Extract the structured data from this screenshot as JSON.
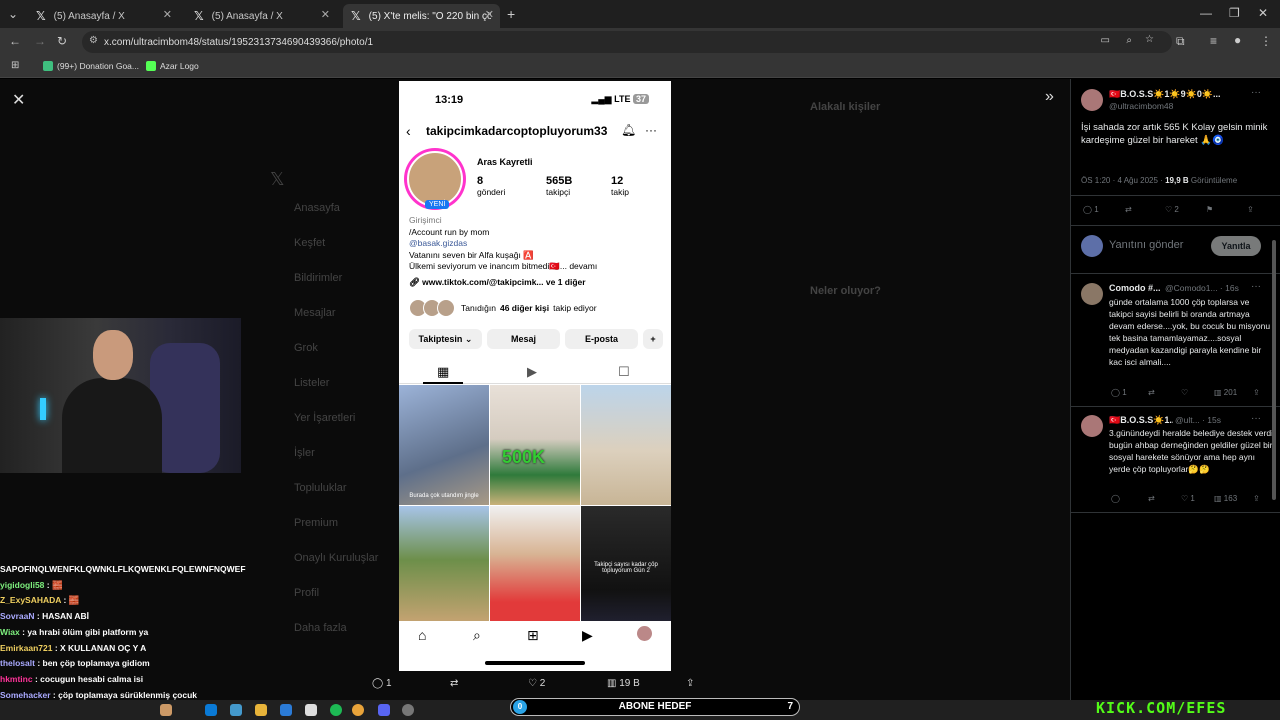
{
  "browser": {
    "tabs": [
      {
        "title": "(5) Anasayfa / X"
      },
      {
        "title": "(5) Anasayfa / X"
      },
      {
        "title": "(5) X'te melis: \"O 220 bin çöpü"
      }
    ],
    "url": "x.com/ultracimbom48/status/1952313734690439366/photo/1",
    "bookmarks": [
      "(99+) Donation Goa...",
      "Azar Logo"
    ]
  },
  "background_nav": [
    "Anasayfa",
    "Keşfet",
    "Bildirimler",
    "Mesajlar",
    "Grok",
    "Listeler",
    "Yer İşaretleri",
    "İşler",
    "Topluluklar",
    "Premium",
    "Onaylı Kuruluşlar",
    "Profil",
    "Daha fazla"
  ],
  "background_right": [
    "Alakalı kişiler",
    "Neler oluyor?"
  ],
  "phone": {
    "time": "13:19",
    "network": "LTE",
    "battery": "37",
    "username": "takipcimkadarcoptopluyorum33",
    "display_name": "Aras Kayretli",
    "badge": "YENİ",
    "stats": [
      {
        "num": "8",
        "label": "gönderi"
      },
      {
        "num": "565B",
        "label": "takipçi"
      },
      {
        "num": "12",
        "label": "takip"
      }
    ],
    "category": "Girişimci",
    "bio_lines": [
      "/Account run by mom",
      "@basak.gizdas",
      "Vatanını seven bir Alfa kuşağı 🅰️",
      "Ülkemi seviyorum ve inancım bitmedi🇹🇷... devamı"
    ],
    "link": "www.tiktok.com/@takipcimk...",
    "link_more": "ve 1 diğer",
    "mutual_prefix": "Tanıdığın",
    "mutual_bold": "46 diğer kişi",
    "mutual_suffix": "takip ediyor",
    "buttons": [
      "Takiptesin",
      "Mesaj",
      "E-posta"
    ],
    "grid_captions": [
      "Burada çok utandım jingle",
      "500K",
      "",
      "",
      "",
      "Takipçi sayısı kadar çöp topluyorum Gün 2"
    ]
  },
  "photo_actions": {
    "replies": "1",
    "reposts": "",
    "likes": "2",
    "views": "19 B"
  },
  "chat": [
    {
      "user": "SAPOFINQLWENFKLQWNKLFLKQWENKLFQLEWNFNQWEF",
      "msg": ""
    },
    {
      "user": "yigidogli58",
      "msg": "🧱"
    },
    {
      "user": "Z_ExySAHADA",
      "msg": "🧱"
    },
    {
      "user": "SovraaN",
      "msg": "HASAN ABİ"
    },
    {
      "user": "Wiax",
      "msg": "ya hrabi ölüm gibi platform ya"
    },
    {
      "user": "Emirkaan721",
      "msg": "X KULLANAN OÇ Y A"
    },
    {
      "user": "thelosalt",
      "msg": "ben çöp toplamaya gidiom"
    },
    {
      "user": "hkmtinc",
      "msg": "cocugun hesabi calma isi"
    },
    {
      "user": "Somehacker",
      "msg": "çöp toplamaya sürüklenmiş çocuk"
    },
    {
      "user": "nabnemuhallahadegilim",
      "msg": "🧱"
    }
  ],
  "overlay": {
    "goal_label": "ABONE HEDEF",
    "goal_current": "0",
    "goal_target": "7",
    "watermark": "KICK.COM/EFES"
  },
  "panel": {
    "main": {
      "name": "🇹🇷B.O.S.S☀️1☀️9☀️0☀️...",
      "handle": "@ultracimbom48",
      "text": "İşi sahada zor artık 565 K Kolay gelsin minik kardeşime güzel bir hareket 🙏🧿",
      "time": "ÖS 1:20 · 4 Ağu 2025 ·",
      "views": "19,9 B",
      "views_label": "Görüntüleme",
      "replies": "1",
      "likes": "2"
    },
    "reply_placeholder": "Yanıtını gönder",
    "reply_button": "Yanıtla",
    "replies": [
      {
        "name": "Comodo #...",
        "handle": "@Comodo1... · 16s",
        "text": "günde ortalama 1000 çöp toplarsa ve takipci sayisi belirli bi oranda artmaya devam ederse....yok, bu cocuk bu misyonu tek basina tamamlayamaz....sosyal medyadan kazandigi parayla kendine bir kac isci almali....",
        "replies": "1",
        "views": "201"
      },
      {
        "name": "🇹🇷B.O.S.S☀️1...",
        "handle": "@ult... · 15s",
        "text": "3.günündeydi heralde belediye destek verdi bugün ahbap derneğinden geldiler güzel bir sosyal harekete sönüyor ama hep aynı yerde çöp topluyorlar🤔🤔",
        "likes": "1",
        "views": "163"
      }
    ]
  }
}
